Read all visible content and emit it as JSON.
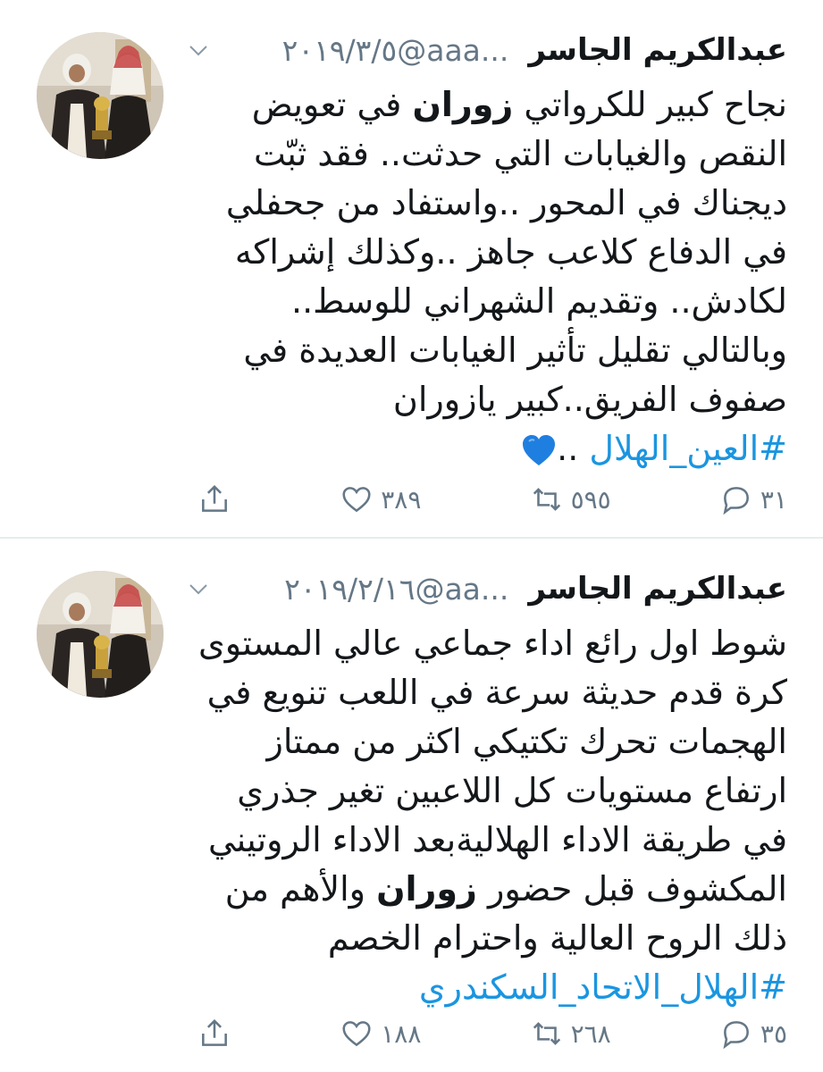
{
  "tweets": [
    {
      "author": {
        "name": "عبدالكريم الجاسر",
        "handle": "@aaa...",
        "date": "٢٠١٩/٣/٥"
      },
      "body": {
        "l1a": "نجاح كبير للكرواتي ",
        "l1b": "زوران",
        "l1c": " في تعويض",
        "l2": "النقص والغيابات التي حدثت.. فقد ثبّت",
        "l3": "ديجناك في المحور ..واستفاد من جحفلي",
        "l4": "في الدفاع كلاعب جاهز ..وكذلك إشراكه",
        "l5": "لكادش.. وتقديم الشهراني للوسط..",
        "l6": "وبالتالي تقليل تأثير الغيابات العديدة في",
        "l7": "صفوف الفريق..كبير يازوران",
        "hashtag": "#العين_الهلال",
        "after_hashtag": " .."
      },
      "replies": "٣١",
      "retweets": "٥٩٥",
      "likes": "٣٨٩"
    },
    {
      "author": {
        "name": "عبدالكريم الجاسر",
        "handle": "@aa...",
        "date": "٢٠١٩/٢/١٦"
      },
      "body": {
        "l1": "شوط اول رائع  اداء جماعي عالي المستوى",
        "l2": "كرة قدم حديثة سرعة في اللعب تنويع في",
        "l3": "الهجمات تحرك تكتيكي اكثر من ممتاز",
        "l4": "ارتفاع مستويات كل اللاعبين تغير جذري",
        "l5": "في طريقة الاداء الهلاليةبعد الاداء الروتيني",
        "l6a": "المكشوف قبل حضور ",
        "l6b": "زوران",
        "l6c": "  والأهم من",
        "l7": "ذلك الروح العالية واحترام الخصم",
        "hashtag": "#الهلال_الاتحاد_السكندري"
      },
      "replies": "٣٥",
      "retweets": "٢٦٨",
      "likes": "١٨٨"
    }
  ],
  "colors": {
    "text": "#14171a",
    "secondary": "#657786",
    "link": "#1b95e0",
    "heart_emoji": "#1f7fe0",
    "divider": "#e6ecf0"
  },
  "icons": {
    "menu": "chevron-down-icon",
    "reply": "reply-icon",
    "retweet": "retweet-icon",
    "like": "heart-icon",
    "share": "share-icon",
    "emoji": "blue-heart-emoji-icon"
  }
}
